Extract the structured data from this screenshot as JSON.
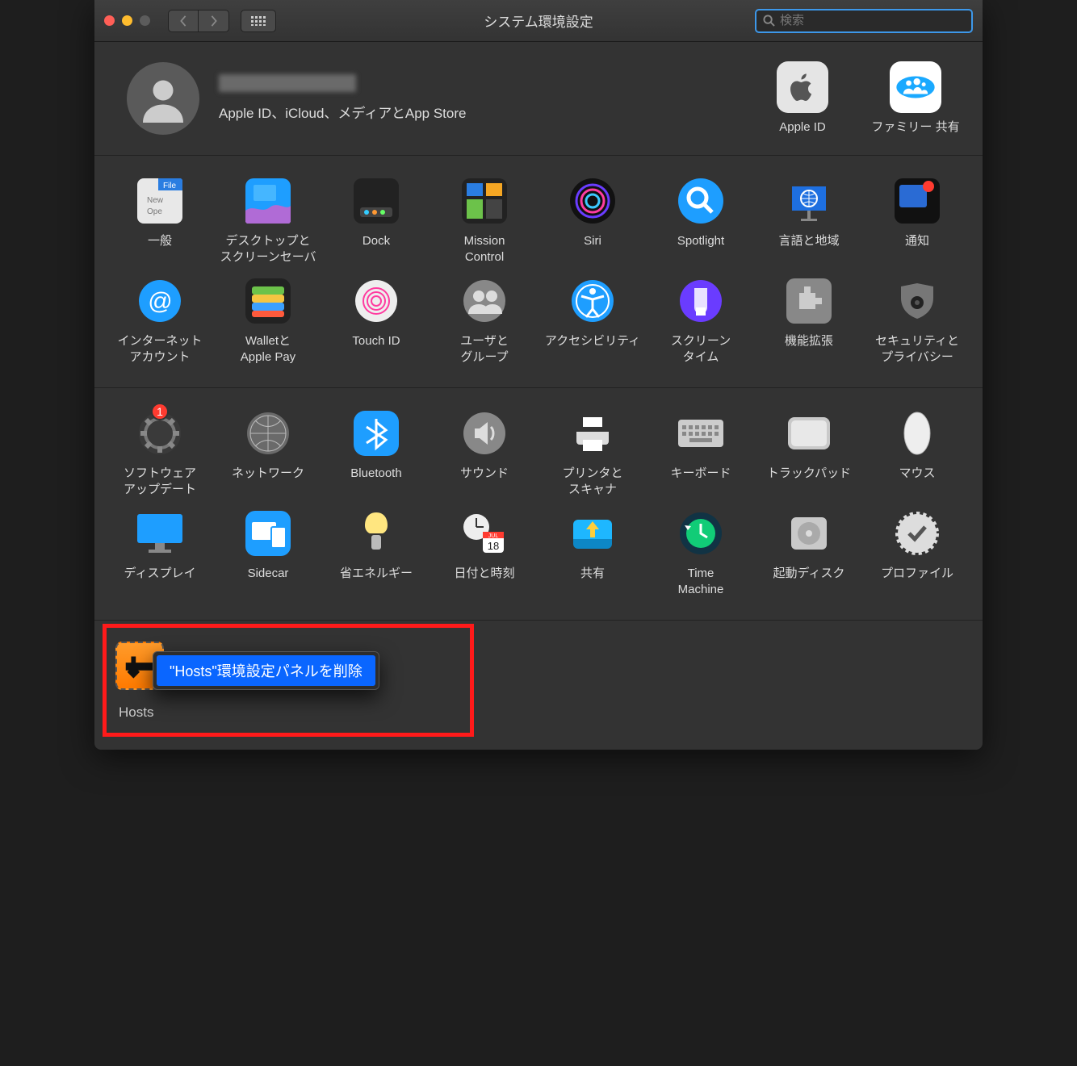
{
  "window": {
    "title": "システム環境設定"
  },
  "search": {
    "placeholder": "検索"
  },
  "account": {
    "subtitle": "Apple ID、iCloud、メディアとApp Store",
    "right": [
      {
        "id": "apple-id",
        "label": "Apple ID"
      },
      {
        "id": "family",
        "label": "ファミリー\n共有"
      }
    ]
  },
  "rows": [
    [
      {
        "id": "general",
        "label": "一般"
      },
      {
        "id": "desktop",
        "label": "デスクトップと\nスクリーンセーバ"
      },
      {
        "id": "dock",
        "label": "Dock"
      },
      {
        "id": "mission",
        "label": "Mission\nControl"
      },
      {
        "id": "siri",
        "label": "Siri"
      },
      {
        "id": "spotlight",
        "label": "Spotlight"
      },
      {
        "id": "lang",
        "label": "言語と地域"
      },
      {
        "id": "notif",
        "label": "通知"
      }
    ],
    [
      {
        "id": "internet",
        "label": "インターネット\nアカウント"
      },
      {
        "id": "wallet",
        "label": "Walletと\nApple Pay"
      },
      {
        "id": "touchid",
        "label": "Touch ID"
      },
      {
        "id": "users",
        "label": "ユーザと\nグループ"
      },
      {
        "id": "a11y",
        "label": "アクセシビリティ"
      },
      {
        "id": "screentime",
        "label": "スクリーン\nタイム"
      },
      {
        "id": "ext",
        "label": "機能拡張"
      },
      {
        "id": "security",
        "label": "セキュリティと\nプライバシー"
      }
    ],
    [
      {
        "id": "swupdate",
        "label": "ソフトウェア\nアップデート",
        "badge": "1"
      },
      {
        "id": "network",
        "label": "ネットワーク"
      },
      {
        "id": "bluetooth",
        "label": "Bluetooth"
      },
      {
        "id": "sound",
        "label": "サウンド"
      },
      {
        "id": "printers",
        "label": "プリンタと\nスキャナ"
      },
      {
        "id": "keyboard",
        "label": "キーボード"
      },
      {
        "id": "trackpad",
        "label": "トラックパッド"
      },
      {
        "id": "mouse",
        "label": "マウス"
      }
    ],
    [
      {
        "id": "displays",
        "label": "ディスプレイ"
      },
      {
        "id": "sidecar",
        "label": "Sidecar"
      },
      {
        "id": "energy",
        "label": "省エネルギー"
      },
      {
        "id": "datetime",
        "label": "日付と時刻"
      },
      {
        "id": "sharing",
        "label": "共有"
      },
      {
        "id": "timemachine",
        "label": "Time\nMachine"
      },
      {
        "id": "startup",
        "label": "起動ディスク"
      },
      {
        "id": "profiles",
        "label": "プロファイル"
      }
    ]
  ],
  "thirdparty": {
    "label": "Hosts",
    "context_item": "\"Hosts\"環境設定パネルを削除"
  },
  "badges": {
    "swupdate": "1"
  },
  "calendar_day": "18",
  "calendar_month": "JUL"
}
